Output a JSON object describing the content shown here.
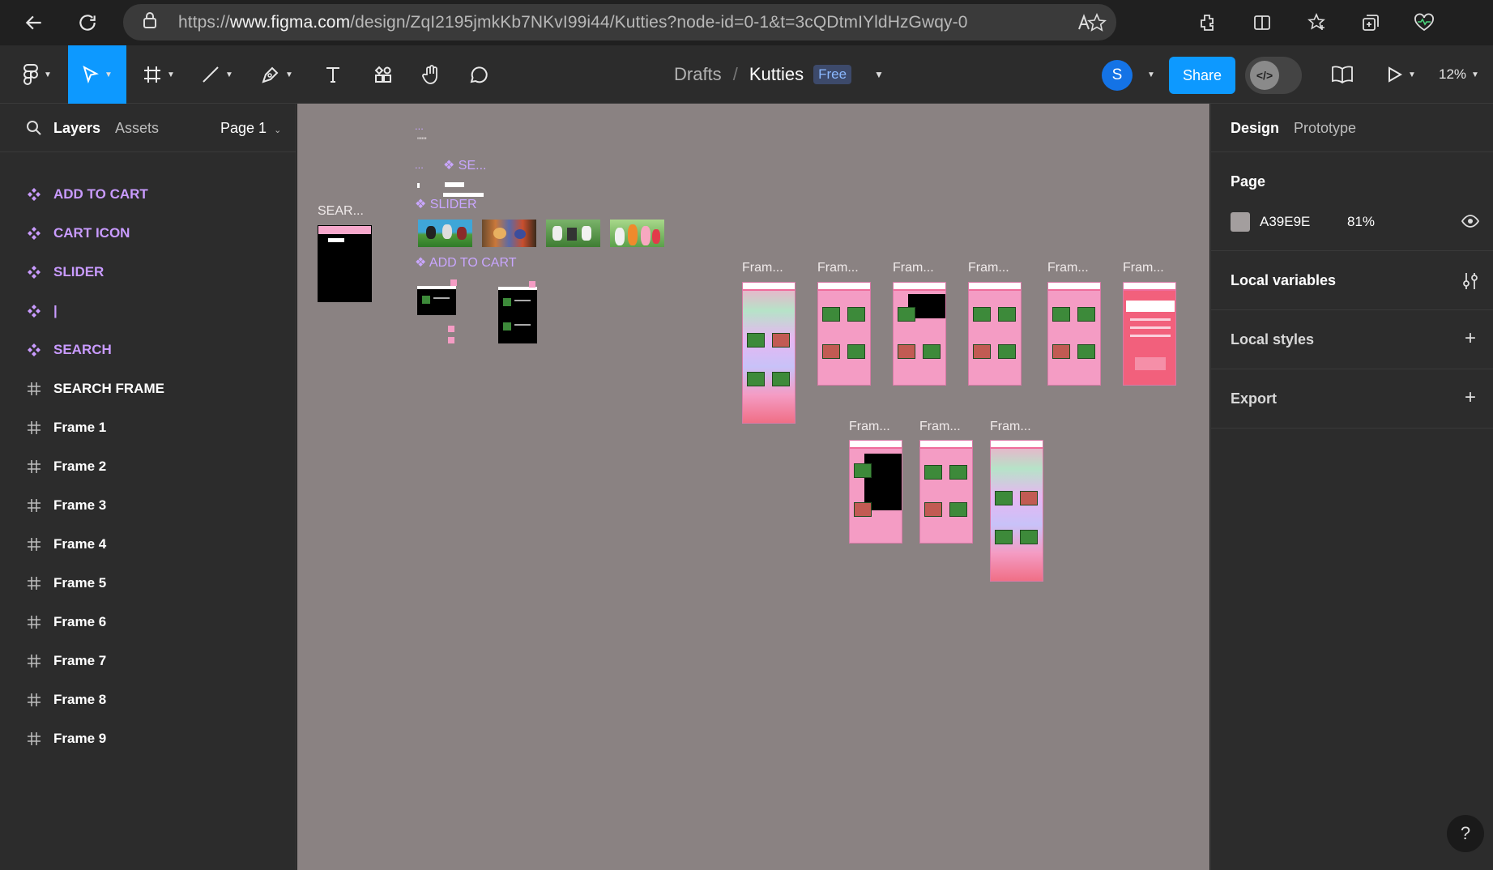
{
  "browser": {
    "url_prefix": "https://",
    "url_host": "www.figma.com",
    "url_path": "/design/ZqI2195jmkKb7NKvI99i44/Kutties?node-id=0-1&t=3cQDtmIYldHzGwqy-0"
  },
  "toolbar": {
    "breadcrumb_drafts": "Drafts",
    "breadcrumb_sep": "/",
    "file_name": "Kutties",
    "plan_badge": "Free",
    "avatar_initial": "S",
    "share_label": "Share",
    "zoom_label": "12%"
  },
  "left_panel": {
    "tab_layers": "Layers",
    "tab_assets": "Assets",
    "page_selector": "Page 1",
    "layers": [
      {
        "name": "ADD TO CART",
        "type": "component"
      },
      {
        "name": "CART ICON",
        "type": "component"
      },
      {
        "name": "SLIDER",
        "type": "component"
      },
      {
        "name": "|",
        "type": "component"
      },
      {
        "name": "SEARCH",
        "type": "component"
      },
      {
        "name": "SEARCH FRAME",
        "type": "frame"
      },
      {
        "name": "Frame 1",
        "type": "frame"
      },
      {
        "name": "Frame 2",
        "type": "frame"
      },
      {
        "name": "Frame 3",
        "type": "frame"
      },
      {
        "name": "Frame 4",
        "type": "frame"
      },
      {
        "name": "Frame 5",
        "type": "frame"
      },
      {
        "name": "Frame 6",
        "type": "frame"
      },
      {
        "name": "Frame 7",
        "type": "frame"
      },
      {
        "name": "Frame 8",
        "type": "frame"
      },
      {
        "name": "Frame 9",
        "type": "frame"
      }
    ]
  },
  "right_panel": {
    "tab_design": "Design",
    "tab_prototype": "Prototype",
    "page_heading": "Page",
    "page_color_hex": "A39E9E",
    "page_opacity": "81%",
    "local_variables": "Local variables",
    "local_styles": "Local styles",
    "export": "Export"
  },
  "canvas": {
    "background": "#8a8282",
    "search_frame_label": "SEAR...",
    "component_labels": {
      "dots1": "...",
      "dots2": "\"\"\"",
      "se": "❖ SE...",
      "dots3": "...",
      "slider": "❖ SLIDER",
      "add_to_cart": "❖ ADD TO CART"
    },
    "frame_labels_row1": [
      "Fram...",
      "Fram...",
      "Fram...",
      "Fram...",
      "Fram...",
      "Fram..."
    ],
    "frame_labels_row2": [
      "Fram...",
      "Fram...",
      "Fram..."
    ]
  },
  "help_label": "?"
}
